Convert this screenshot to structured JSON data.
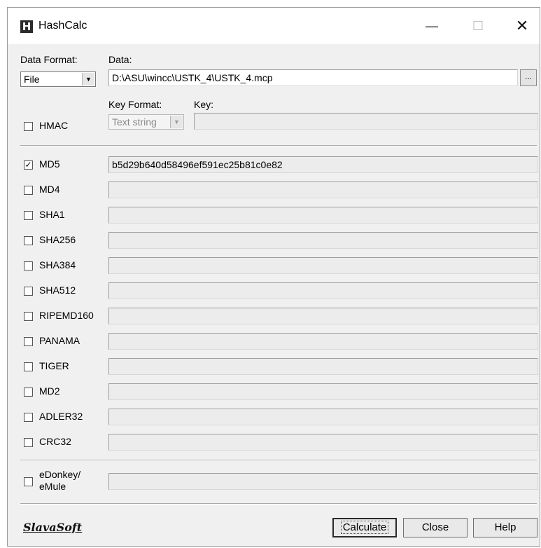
{
  "window": {
    "title": "HashCalc",
    "icon_letter": "H"
  },
  "title_controls": {
    "minimize": "—",
    "maximize": "☐",
    "close": "✕"
  },
  "input": {
    "data_format_label": "Data Format:",
    "data_format_value": "File",
    "data_label": "Data:",
    "data_value": "D:\\ASU\\wincc\\USTK_4\\USTK_4.mcp",
    "browse_label": "..."
  },
  "hmac": {
    "label": "HMAC",
    "checked": false,
    "key_format_label": "Key Format:",
    "key_format_value": "Text string",
    "key_label": "Key:",
    "key_value": ""
  },
  "algorithms": [
    {
      "name": "MD5",
      "checked": true,
      "value": "b5d29b640d58496ef591ec25b81c0e82"
    },
    {
      "name": "MD4",
      "checked": false,
      "value": ""
    },
    {
      "name": "SHA1",
      "checked": false,
      "value": ""
    },
    {
      "name": "SHA256",
      "checked": false,
      "value": ""
    },
    {
      "name": "SHA384",
      "checked": false,
      "value": ""
    },
    {
      "name": "SHA512",
      "checked": false,
      "value": ""
    },
    {
      "name": "RIPEMD160",
      "checked": false,
      "value": ""
    },
    {
      "name": "PANAMA",
      "checked": false,
      "value": ""
    },
    {
      "name": "TIGER",
      "checked": false,
      "value": ""
    },
    {
      "name": "MD2",
      "checked": false,
      "value": ""
    },
    {
      "name": "ADLER32",
      "checked": false,
      "value": ""
    },
    {
      "name": "CRC32",
      "checked": false,
      "value": ""
    }
  ],
  "edonkey": {
    "label_line1": "eDonkey/",
    "label_line2": "eMule",
    "checked": false,
    "value": ""
  },
  "footer": {
    "brand": "SlavaSoft",
    "calculate": "Calculate",
    "close": "Close",
    "help": "Help"
  }
}
